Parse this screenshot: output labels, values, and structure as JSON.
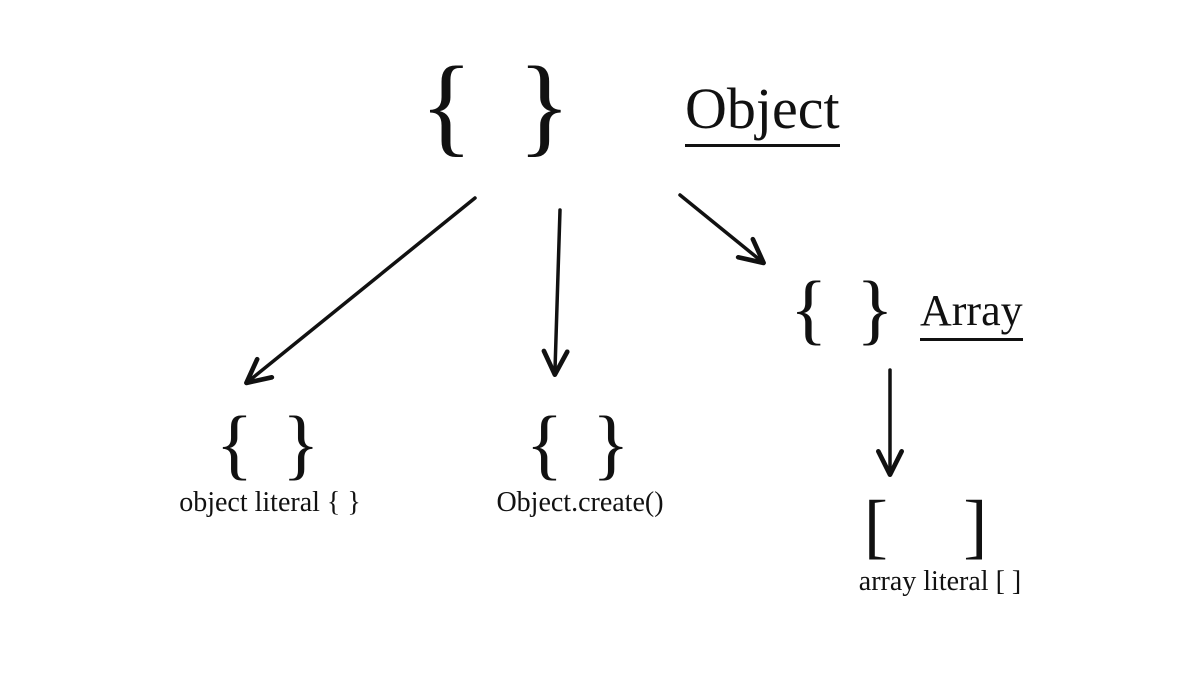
{
  "diagram": {
    "root": {
      "glyph": "{ }",
      "label": "Object"
    },
    "children": {
      "objectLiteral": {
        "glyph": "{ }",
        "caption": "object literal { }"
      },
      "objectCreate": {
        "glyph": "{ }",
        "caption": "Object.create()"
      },
      "array": {
        "glyph": "{ }",
        "label": "Array",
        "child": {
          "glyph": "[ ]",
          "caption": "array literal [ ]"
        }
      }
    }
  }
}
